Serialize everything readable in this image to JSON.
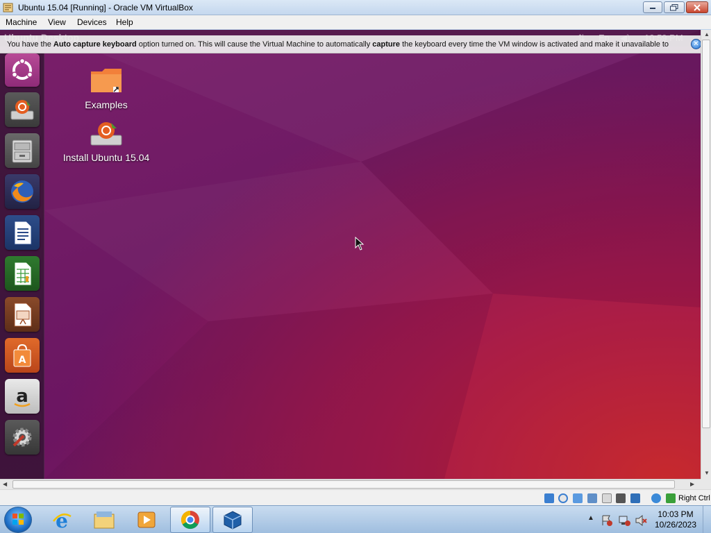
{
  "window": {
    "title": "Ubuntu 15.04 [Running] - Oracle VM VirtualBox"
  },
  "menubar": [
    "Machine",
    "View",
    "Devices",
    "Help"
  ],
  "guest": {
    "top_panel_title": "Ubuntu Desktop",
    "top_panel_clock": "10:59 PM",
    "notice": {
      "p1": "You have the ",
      "b1": "Auto capture keyboard",
      "p2": " option turned on. This will cause the Virtual Machine to automatically ",
      "b2": "capture",
      "p3": " the keyboard every time the VM window is activated and make it unavailable to"
    },
    "launcher": [
      "dash-home",
      "install-ubuntu",
      "files",
      "firefox",
      "writer",
      "calc",
      "impress",
      "software-center",
      "amazon",
      "system-settings"
    ],
    "desktop_icons": [
      {
        "label": "Examples",
        "icon": "folder-icon"
      },
      {
        "label": "Install Ubuntu 15.04",
        "icon": "installer-icon"
      }
    ]
  },
  "statusbar": {
    "host_key": "Right Ctrl"
  },
  "taskbar": {
    "apps": [
      "internet-explorer",
      "windows-explorer",
      "media-player",
      "chrome",
      "virtualbox"
    ],
    "time": "10:03 PM",
    "date": "10/26/2023"
  }
}
